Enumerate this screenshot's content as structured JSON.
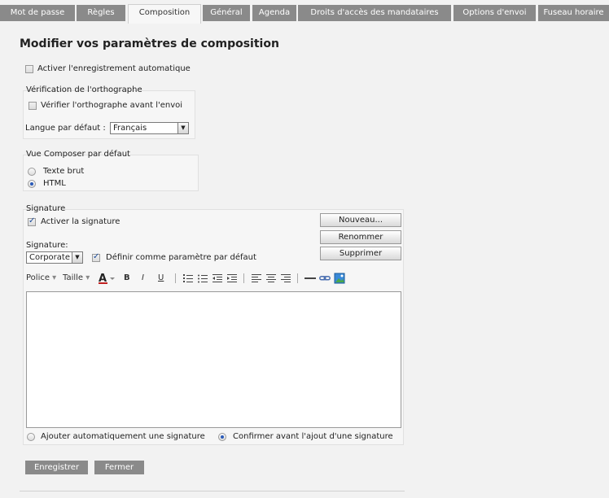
{
  "tabs": [
    {
      "label": "Mot de passe",
      "active": false
    },
    {
      "label": "Règles",
      "active": false
    },
    {
      "label": "Composition",
      "active": true
    },
    {
      "label": "Général",
      "active": false
    },
    {
      "label": "Agenda",
      "active": false
    },
    {
      "label": "Droits d'accès des mandataires",
      "active": false
    },
    {
      "label": "Options d'envoi",
      "active": false
    },
    {
      "label": "Fuseau horaire",
      "active": false
    }
  ],
  "page_title": "Modifier vos paramètres de composition",
  "autosave": {
    "label": "Activer l'enregistrement automatique",
    "checked": false
  },
  "spelling": {
    "legend": "Vérification de l'orthographe",
    "check_label": "Vérifier l'orthographe avant l'envoi",
    "checked": false,
    "language_label": "Langue par défaut :",
    "language_value": "Français"
  },
  "compose_view": {
    "legend": "Vue Composer par défaut",
    "options": [
      "Texte brut",
      "HTML"
    ],
    "selected": "HTML"
  },
  "signature": {
    "legend": "Signature",
    "enable_label": "Activer la signature",
    "enabled": true,
    "select_label": "Signature:",
    "select_value": "Corporate",
    "default_label": "Définir comme paramètre par défaut",
    "default_checked": true,
    "buttons": {
      "new": "Nouveau...",
      "rename": "Renommer",
      "delete": "Supprimer"
    },
    "toolbar": {
      "font": "Police",
      "size": "Taille",
      "bold": "B",
      "italic": "I",
      "underline": "U"
    },
    "auto_add_label": "Ajouter automatiquement une signature",
    "confirm_label": "Confirmer avant l'ajout d'une signature",
    "insert_mode": "confirm"
  },
  "actions": {
    "save": "Enregistrer",
    "close": "Fermer"
  }
}
